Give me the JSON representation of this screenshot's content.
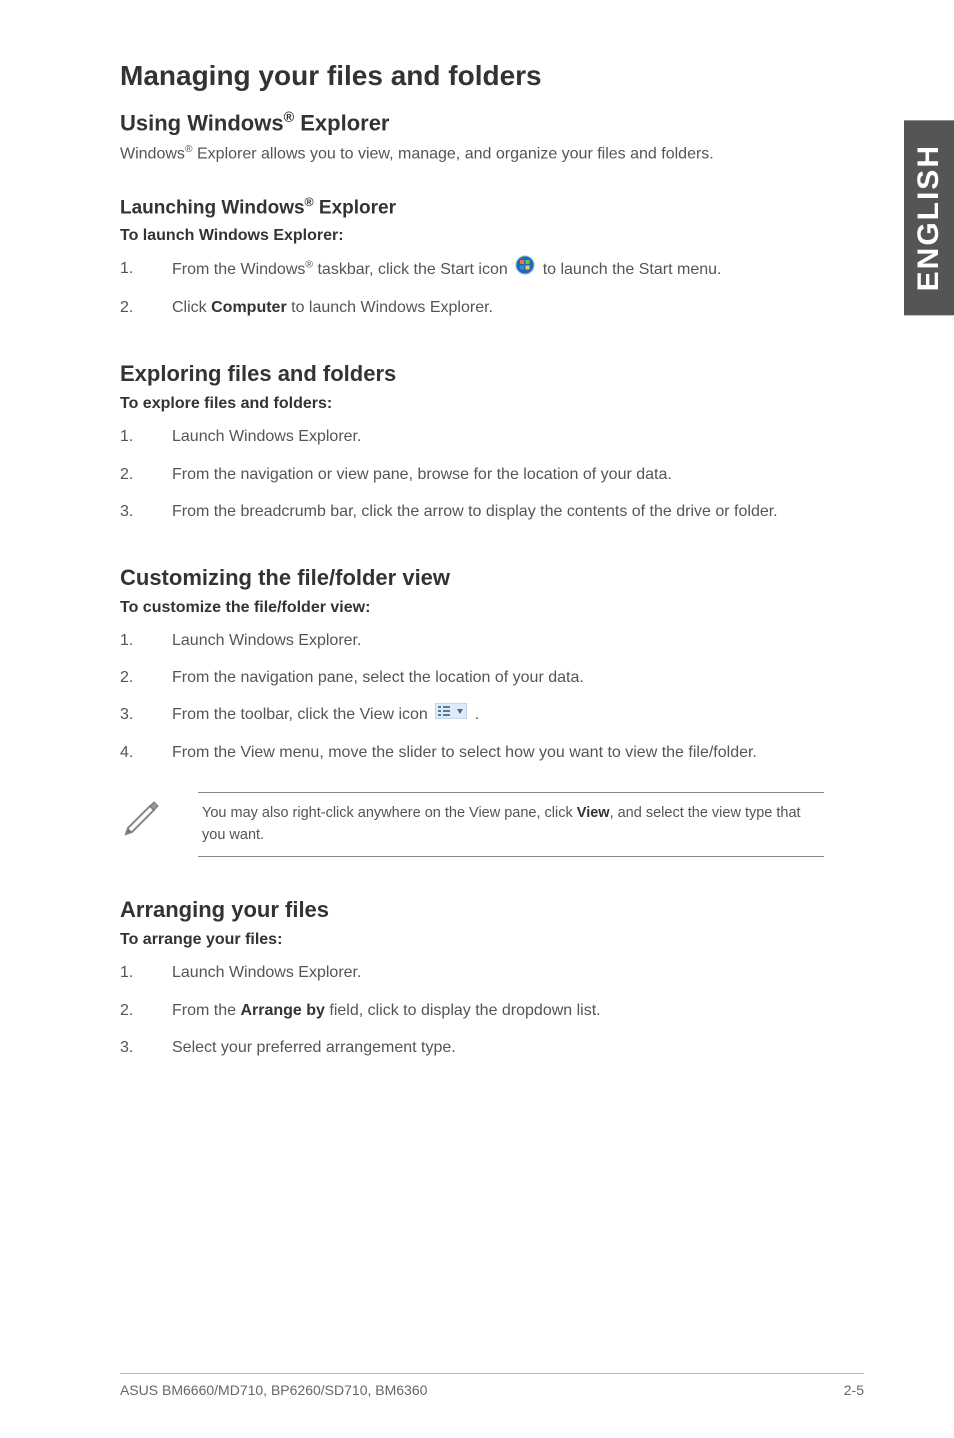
{
  "sideTab": "ENGLISH",
  "h1": "Managing your files and folders",
  "sec1": {
    "title_pre": "Using Windows",
    "title_post": " Explorer",
    "intro_pre": "Windows",
    "intro_post": " Explorer allows you to view, manage, and organize your files and folders.",
    "sub_pre": "Launching Windows",
    "sub_post": " Explorer",
    "lead": "To launch Windows Explorer:",
    "li1_num": "1.",
    "li1a": "From the Windows",
    "li1b": " taskbar, click the Start icon ",
    "li1c": " to launch the Start menu.",
    "li2_num": "2.",
    "li2a": "Click ",
    "li2b": "Computer",
    "li2c": " to launch Windows Explorer."
  },
  "sec2": {
    "title": "Exploring files and folders",
    "lead": "To explore files and folders:",
    "li1_num": "1.",
    "li1": "Launch Windows Explorer.",
    "li2_num": "2.",
    "li2": "From the navigation or view pane, browse for the location of your data.",
    "li3_num": "3.",
    "li3": "From the breadcrumb bar, click the arrow to display the contents of the drive or folder."
  },
  "sec3": {
    "title": "Customizing the file/folder view",
    "lead": "To customize the file/folder view:",
    "li1_num": "1.",
    "li1": "Launch Windows Explorer.",
    "li2_num": "2.",
    "li2": "From the navigation pane, select the location of your data.",
    "li3_num": "3.",
    "li3a": "From the toolbar, click the View icon ",
    "li3b": ".",
    "li4_num": "4.",
    "li4": "From the View menu, move the slider to select how you want to view the file/folder.",
    "note_a": "You may also right-click anywhere on the View pane, click ",
    "note_b": "View",
    "note_c": ", and select the view type that you want."
  },
  "sec4": {
    "title": "Arranging your files",
    "lead": "To arrange your files:",
    "li1_num": "1.",
    "li1": "Launch Windows Explorer.",
    "li2_num": "2.",
    "li2a": "From the ",
    "li2b": "Arrange by",
    "li2c": " field, click to display the dropdown list.",
    "li3_num": "3.",
    "li3": "Select your preferred arrangement type."
  },
  "footer": {
    "left": "ASUS BM6660/MD710, BP6260/SD710, BM6360",
    "right": "2-5"
  },
  "reg": "®"
}
